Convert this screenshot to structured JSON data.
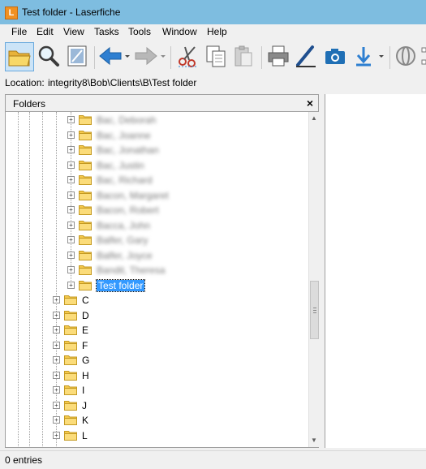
{
  "window": {
    "title": "Test folder - Laserfiche",
    "logo_letter": "L"
  },
  "menu": [
    "File",
    "Edit",
    "View",
    "Tasks",
    "Tools",
    "Window",
    "Help"
  ],
  "toolbar": {
    "buttons": [
      "open-folder",
      "search",
      "view-document",
      "back",
      "forward",
      "cut",
      "copy",
      "paste",
      "print",
      "scan",
      "snapshot",
      "import",
      "web-access"
    ]
  },
  "location": {
    "label": "Location:",
    "path": "integrity8\\Bob\\Clients\\B\\Test folder"
  },
  "folders_panel": {
    "title": "Folders",
    "close_glyph": "×",
    "blurred_items": [
      "Bac, Deborah",
      "Bac, Joanne",
      "Bac, Jonathan",
      "Bac, Justin",
      "Bac, Richard",
      "Bacon, Margaret",
      "Bacon, Robert",
      "Bacca, John",
      "Balfer, Gary",
      "Balfer, Joyce",
      "Bandit, Theresa"
    ],
    "selected_item": "Test folder",
    "letter_items": [
      "C",
      "D",
      "E",
      "F",
      "G",
      "H",
      "I",
      "J",
      "K",
      "L"
    ]
  },
  "status": {
    "text": "0 entries"
  },
  "colors": {
    "titlebar": "#7ebde0",
    "selection": "#3399ff",
    "folder": "#f5c94d",
    "logo": "#f09122"
  }
}
